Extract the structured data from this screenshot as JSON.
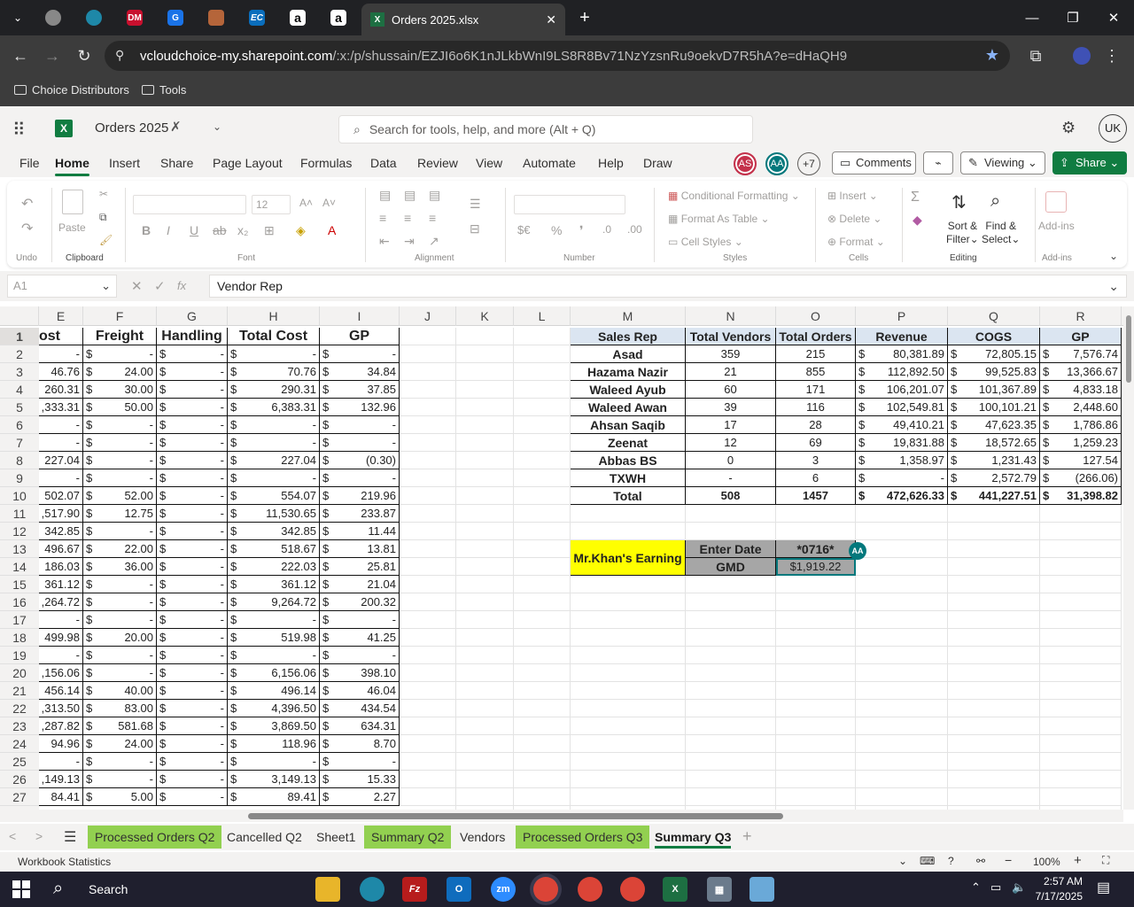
{
  "browser": {
    "tab_title": "Orders 2025.xlsx",
    "tab_xl_icon": "X",
    "url_domain": "vcloudchoice-my.sharepoint.com",
    "url_path": "/:x:/p/shussain/EZJI6o6K1nJLkbWnI9LS8R8Bv71NzYzsnRu9oekvD7R5hA?e=dHaQH9",
    "pinned_tabs": [
      "chromium-icon",
      "edge-icon",
      "pdf-icon",
      "g-icon",
      "box-icon",
      "ec-icon",
      "amazon-icon",
      "amazon-icon-2"
    ],
    "pinned_labels": [
      "",
      "",
      "DM",
      "G",
      "",
      "EC",
      "a",
      "a"
    ],
    "bookmarks": [
      "Choice Distributors",
      "Tools"
    ]
  },
  "excel": {
    "file_name": "Orders 2025",
    "search_placeholder": "Search for tools, help, and more (Alt + Q)",
    "user_initials": "UK",
    "collab_as": "AS",
    "collab_aa": "AA",
    "collab_more": "+7",
    "comments_label": "Comments",
    "viewing_label": "Viewing",
    "share_label": "Share",
    "menus": [
      "File",
      "Home",
      "Insert",
      "Share",
      "Page Layout",
      "Formulas",
      "Data",
      "Review",
      "View",
      "Automate",
      "Help",
      "Draw"
    ],
    "active_menu": "Home"
  },
  "ribbon": {
    "groups": [
      "Undo",
      "Clipboard",
      "Font",
      "Alignment",
      "Number",
      "Styles",
      "Cells",
      "Editing",
      "Add-ins"
    ],
    "paste": "Paste",
    "font_size": "12",
    "conditional_formatting": "Conditional Formatting",
    "format_as_table": "Format As Table",
    "cell_styles": "Cell Styles",
    "insert": "Insert",
    "delete": "Delete",
    "format": "Format",
    "sort_filter_1": "Sort &",
    "sort_filter_2": "Filter",
    "find_select_1": "Find &",
    "find_select_2": "Select",
    "addins": "Add-ins"
  },
  "formula_bar": {
    "name_box": "A1",
    "fx": "fx",
    "formula": "Vendor Rep"
  },
  "columns": [
    "E",
    "F",
    "G",
    "H",
    "I",
    "J",
    "K",
    "L",
    "M",
    "N",
    "O",
    "P",
    "Q",
    "R"
  ],
  "left_table": {
    "headers": [
      "ost",
      "Freight",
      "Handling",
      "Total Cost",
      "GP"
    ],
    "rows": [
      [
        "-",
        "-",
        "-",
        "-",
        "-"
      ],
      [
        "46.76",
        "24.00",
        "-",
        "70.76",
        "34.84"
      ],
      [
        "260.31",
        "30.00",
        "-",
        "290.31",
        "37.85"
      ],
      [
        ",333.31",
        "50.00",
        "-",
        "6,383.31",
        "132.96"
      ],
      [
        "-",
        "-",
        "-",
        "-",
        "-"
      ],
      [
        "-",
        "-",
        "-",
        "-",
        "-"
      ],
      [
        "227.04",
        "-",
        "-",
        "227.04",
        "(0.30)"
      ],
      [
        "-",
        "-",
        "-",
        "-",
        "-"
      ],
      [
        "502.07",
        "52.00",
        "-",
        "554.07",
        "219.96"
      ],
      [
        ",517.90",
        "12.75",
        "-",
        "11,530.65",
        "233.87"
      ],
      [
        "342.85",
        "-",
        "-",
        "342.85",
        "11.44"
      ],
      [
        "496.67",
        "22.00",
        "-",
        "518.67",
        "13.81"
      ],
      [
        "186.03",
        "36.00",
        "-",
        "222.03",
        "25.81"
      ],
      [
        "361.12",
        "-",
        "-",
        "361.12",
        "21.04"
      ],
      [
        ",264.72",
        "-",
        "-",
        "9,264.72",
        "200.32"
      ],
      [
        "-",
        "-",
        "-",
        "-",
        "-"
      ],
      [
        "499.98",
        "20.00",
        "-",
        "519.98",
        "41.25"
      ],
      [
        "-",
        "-",
        "-",
        "-",
        "-"
      ],
      [
        ",156.06",
        "-",
        "-",
        "6,156.06",
        "398.10"
      ],
      [
        "456.14",
        "40.00",
        "-",
        "496.14",
        "46.04"
      ],
      [
        ",313.50",
        "83.00",
        "-",
        "4,396.50",
        "434.54"
      ],
      [
        ",287.82",
        "581.68",
        "-",
        "3,869.50",
        "634.31"
      ],
      [
        "94.96",
        "24.00",
        "-",
        "118.96",
        "8.70"
      ],
      [
        "-",
        "-",
        "-",
        "-",
        "-"
      ],
      [
        ",149.13",
        "-",
        "-",
        "3,149.13",
        "15.33"
      ],
      [
        "84.41",
        "5.00",
        "-",
        "89.41",
        "2.27"
      ]
    ]
  },
  "summary_table": {
    "headers": [
      "Sales Rep",
      "Total Vendors",
      "Total Orders",
      "Revenue",
      "COGS",
      "GP"
    ],
    "rows": [
      [
        "Asad",
        "359",
        "215",
        "80,381.89",
        "72,805.15",
        "7,576.74"
      ],
      [
        "Hazama Nazir",
        "21",
        "855",
        "112,892.50",
        "99,525.83",
        "13,366.67"
      ],
      [
        "Waleed Ayub",
        "60",
        "171",
        "106,201.07",
        "101,367.89",
        "4,833.18"
      ],
      [
        "Waleed Awan",
        "39",
        "116",
        "102,549.81",
        "100,101.21",
        "2,448.60"
      ],
      [
        "Ahsan Saqib",
        "17",
        "28",
        "49,410.21",
        "47,623.35",
        "1,786.86"
      ],
      [
        "Zeenat",
        "12",
        "69",
        "19,831.88",
        "18,572.65",
        "1,259.23"
      ],
      [
        "Abbas BS",
        "0",
        "3",
        "1,358.97",
        "1,231.43",
        "127.54"
      ],
      [
        "TXWH",
        "-",
        "6",
        "-",
        "2,572.79",
        "(266.06)"
      ],
      [
        "Total",
        "508",
        "1457",
        "472,626.33",
        "441,227.51",
        "31,398.82"
      ]
    ]
  },
  "earning_box": {
    "title": "Mr.Khan's Earning",
    "enter_date_label": "Enter Date",
    "enter_date_value": "*0716*",
    "gmd_label": "GMD",
    "gmd_value": "$1,919.22",
    "presence_initials": "AA"
  },
  "currency": "$",
  "sheet_tabs": [
    {
      "label": "Processed Orders Q2",
      "green": true
    },
    {
      "label": "Cancelled Q2",
      "green": false
    },
    {
      "label": "Sheet1",
      "green": false
    },
    {
      "label": "Summary Q2",
      "green": true
    },
    {
      "label": "Vendors",
      "green": false
    },
    {
      "label": "Processed Orders Q3",
      "green": true
    },
    {
      "label": "Summary Q3",
      "green": false,
      "active": true
    }
  ],
  "status_bar": {
    "left": "Workbook Statistics",
    "zoom": "100%"
  },
  "taskbar": {
    "search": "Search",
    "time": "2:57 AM",
    "date": "7/17/2025"
  },
  "colors": {
    "excel_green": "#107c41",
    "tab_green": "#92d050",
    "header_blue": "#dbe5f1",
    "earning_yellow": "#ffff00",
    "earning_gray": "#a6a6a6"
  }
}
